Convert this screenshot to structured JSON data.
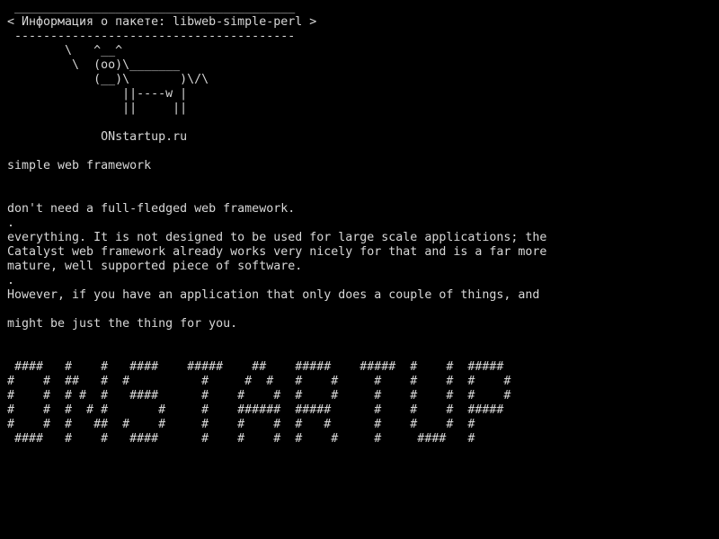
{
  "terminal": {
    "text_color": "#d8d8d8",
    "background_color": "#000000",
    "cowsay": {
      "bubble_top": " _______________________________________",
      "bubble_text": "< Информация о пакете: libweb-simple-perl >",
      "bubble_bottom": " ---------------------------------------",
      "cow_lines": [
        "        \\   ^__^",
        "         \\  (oo)\\_______",
        "            (__)\\       )\\/\\",
        "                ||----w |",
        "                ||     ||"
      ]
    },
    "site_label": "             ONstartup.ru",
    "description_lines": [
      "",
      "simple web framework",
      "",
      "",
      "don't need a full-fledged web framework.",
      ".",
      "everything. It is not designed to be used for large scale applications; the",
      "Catalyst web framework already works very nicely for that and is a far more",
      "mature, well supported piece of software.",
      ".",
      "However, if you have an application that only does a couple of things, and",
      "",
      "might be just the thing for you.",
      "",
      ""
    ],
    "banner_lines": [
      " ####   #    #   ####    #####    ##    #####    #####  #    #  #####",
      "#    #  ##   #  #          #     #  #   #    #     #    #    #  #    #",
      "#    #  # #  #   ####      #    #    #  #    #     #    #    #  #    #",
      "#    #  #  # #       #     #    ######  #####      #    #    #  #####",
      "#    #  #   ##  #    #     #    #    #  #   #      #    #    #  #",
      " ####   #    #   ####      #    #    #  #    #     #     ####   #"
    ]
  }
}
